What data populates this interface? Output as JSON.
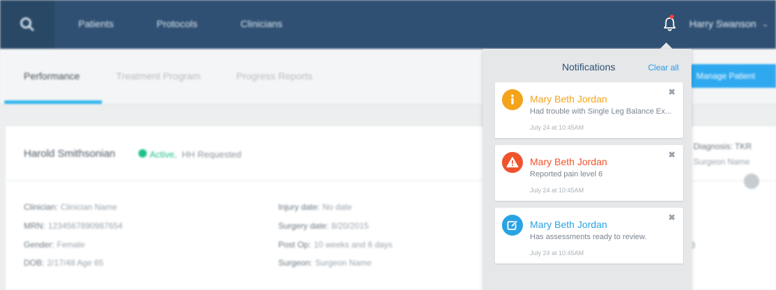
{
  "nav": {
    "links": [
      "Patients",
      "Protocols",
      "Clinicians"
    ],
    "user_name": "Harry Swanson",
    "user_caret": "⌄"
  },
  "tabs": [
    "Performance",
    "Treatment Program",
    "Progress Reports"
  ],
  "manage_button": "Manage Patient",
  "patient": {
    "name": "Harold Smithsonian",
    "status": "Active,",
    "status_extra": "HH Requested",
    "left_details": [
      {
        "label": "Clinician:",
        "value": "Clinician Name"
      },
      {
        "label": "MRN:",
        "value": "1234567890987654"
      },
      {
        "label": "Gender:",
        "value": "Female"
      },
      {
        "label": "DOB:",
        "value": "2/17/48 Age 65"
      }
    ],
    "right_details": [
      {
        "label": "Injury date:",
        "value": "No date"
      },
      {
        "label": "Surgery date:",
        "value": "8/20/2015"
      },
      {
        "label": "Post Op:",
        "value": "10 weeks and 6 days"
      },
      {
        "label": "Surgeon:",
        "value": "Surgeon Name"
      }
    ],
    "diagnosis_label": "Diagnosis:",
    "diagnosis_value": "TKR",
    "surgeon_name_right": "Surgeon Name",
    "tiny_glyph": "3"
  },
  "notifications": {
    "title": "Notifications",
    "clear_all": "Clear all",
    "items": [
      {
        "name": "Mary Beth Jordan",
        "message": "Had trouble with Single Leg Balance Ex...",
        "time": "July 24 at 10:45AM",
        "color": "#f5a31a",
        "icon": "info-icon",
        "glyph": "i"
      },
      {
        "name": "Mary Beth Jordan",
        "message": "Reported pain level 6",
        "time": "July 24 at 10:45AM",
        "color": "#f0522b",
        "icon": "warning-icon",
        "glyph": "!"
      },
      {
        "name": "Mary Beth Jordan",
        "message": "Has assessments ready to review.",
        "time": "July 24 at 10:45AM",
        "color": "#2aa3e3",
        "icon": "edit-icon",
        "glyph": "✎"
      }
    ],
    "close_glyph": "✖"
  }
}
